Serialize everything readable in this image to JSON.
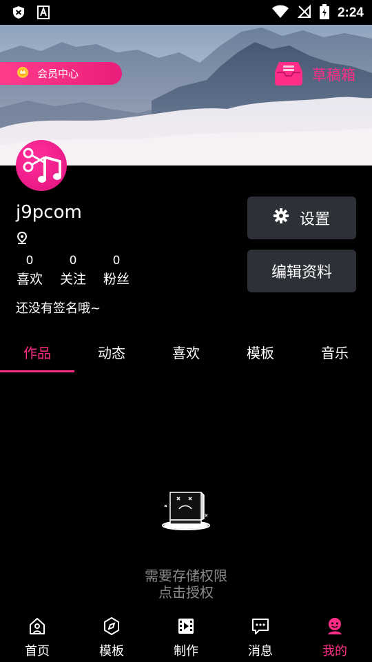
{
  "status_bar": {
    "time": "2:24"
  },
  "banner": {
    "vip_label": "会员中心",
    "draft_label": "草稿箱"
  },
  "profile": {
    "username": "j9pcom",
    "stats": [
      {
        "count": "0",
        "label": "喜欢"
      },
      {
        "count": "0",
        "label": "关注"
      },
      {
        "count": "0",
        "label": "粉丝"
      }
    ],
    "signature": "还没有签名哦~"
  },
  "buttons": {
    "settings_label": "设置",
    "edit_label": "编辑资料"
  },
  "tabs": [
    {
      "label": "作品",
      "active": true
    },
    {
      "label": "动态"
    },
    {
      "label": "喜欢"
    },
    {
      "label": "模板"
    },
    {
      "label": "音乐"
    }
  ],
  "empty_state": {
    "line1": "需要存储权限",
    "line2": "点击授权"
  },
  "bottom_nav": [
    {
      "label": "首页",
      "icon": "home-icon"
    },
    {
      "label": "模板",
      "icon": "compass-icon"
    },
    {
      "label": "制作",
      "icon": "film-icon"
    },
    {
      "label": "消息",
      "icon": "message-icon"
    },
    {
      "label": "我的",
      "icon": "profile-icon",
      "active": true
    }
  ],
  "colors": {
    "accent": "#ff2d86",
    "button_bg": "#2d3036",
    "background": "#000000"
  }
}
